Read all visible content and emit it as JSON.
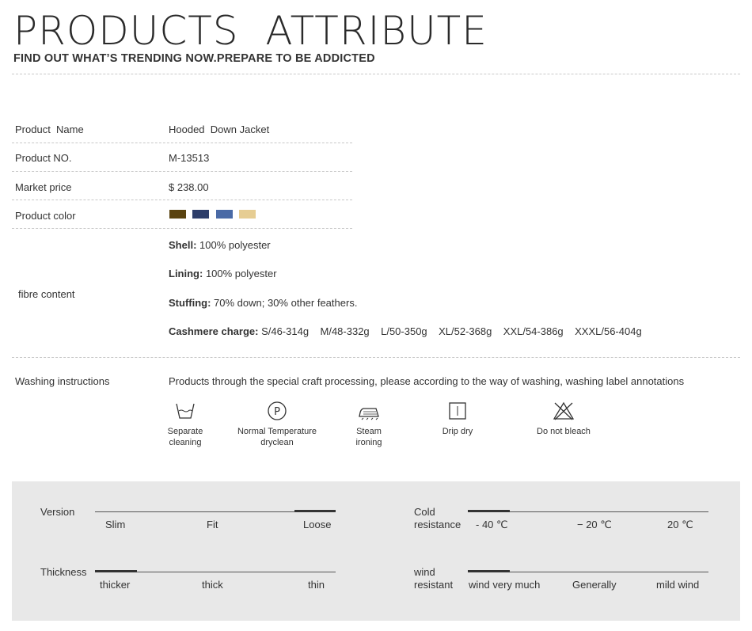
{
  "header": {
    "title": "PRODUCTS  ATTRIBUTE",
    "subtitle": "FIND OUT WHAT’S TRENDING NOW.PREPARE TO BE ADDICTED"
  },
  "attributes": {
    "name_label": "Product  Name",
    "name_value": "Hooded  Down Jacket",
    "no_label": "Product NO.",
    "no_value": "M-13513",
    "price_label": "Market price",
    "price_value": "$ 238.00",
    "color_label": "Product color",
    "colors": [
      "#5a4310",
      "#2d3e6a",
      "#4a6aa6",
      "#e6cd93"
    ],
    "fibre_label": "fibre content",
    "shell_key": "Shell:",
    "shell_val": " 100% polyester",
    "lining_key": "Lining:",
    "lining_val": " 100% polyester",
    "stuffing_key": "Stuffing:",
    "stuffing_val": " 70% down; 30% other feathers.",
    "cashmere_key": "Cashmere charge:",
    "cashmere_val": " S/46-314g    M/48-332g    L/50-350g    XL/52-368g    XXL/54-386g    XXXL/56-404g"
  },
  "washing": {
    "label": "Washing instructions",
    "description": "Products through the special craft processing, please according to the way of washing, washing label annotations",
    "items": [
      {
        "icon": "tub-icon",
        "line1": "Separate",
        "line2": "cleaning"
      },
      {
        "icon": "dryclean-p-icon",
        "line1": "Normal Temperature",
        "line2": "dryclean"
      },
      {
        "icon": "steam-iron-icon",
        "line1": "Steam",
        "line2": "ironing"
      },
      {
        "icon": "drip-dry-icon",
        "line1": "Drip dry",
        "line2": ""
      },
      {
        "icon": "no-bleach-icon",
        "line1": "Do not bleach",
        "line2": ""
      }
    ]
  },
  "scales": {
    "version": {
      "label": "Version",
      "ticks": [
        "Slim",
        "Fit",
        "Loose"
      ],
      "selected": "Loose"
    },
    "thickness": {
      "label": "Thickness",
      "ticks": [
        "thicker",
        "thick",
        "thin"
      ],
      "selected": "thicker"
    },
    "cold": {
      "label_line1": "Cold",
      "label_line2": "resistance",
      "ticks": [
        "- 40 ℃",
        "− 20 ℃",
        "20 ℃"
      ],
      "selected": "- 40 ℃"
    },
    "wind": {
      "label_line1": "wind",
      "label_line2": "resistant",
      "ticks": [
        "wind very much",
        "Generally",
        "mild wind"
      ],
      "selected": "wind very much"
    }
  }
}
